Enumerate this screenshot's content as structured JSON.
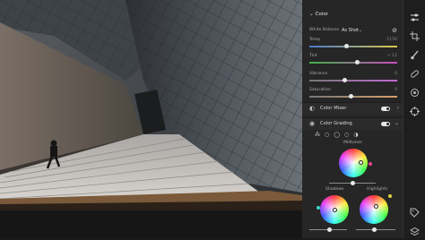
{
  "panel": {
    "color_header": "Color",
    "white_balance_label": "White Balance",
    "white_balance_value": "As Shot",
    "sliders": [
      {
        "label": "Temp",
        "value": "5150",
        "level": 0.42
      },
      {
        "label": "Tint",
        "value": "+ 12",
        "level": 0.55
      },
      {
        "label": "Vibrance",
        "value": "0",
        "level": 0.4
      },
      {
        "label": "Saturation",
        "value": "0",
        "level": 0.47
      }
    ],
    "color_mixer_label": "Color Mixer",
    "color_grading_label": "Color Grading",
    "midtones_label": "Midtones",
    "shadows_label": "Shadows",
    "highlights_label": "Highlights"
  },
  "icons": {
    "tools": [
      "sliders-icon",
      "crop-icon",
      "brush-icon",
      "heal-icon",
      "circle-mask-icon",
      "target-icon",
      "tag-icon",
      "layers-icon"
    ]
  },
  "colors": {
    "panel_bg": "#262626",
    "accent_magenta": "#e8458a",
    "accent_yellow": "#e3d443",
    "accent_teal": "#3bd7c6"
  }
}
